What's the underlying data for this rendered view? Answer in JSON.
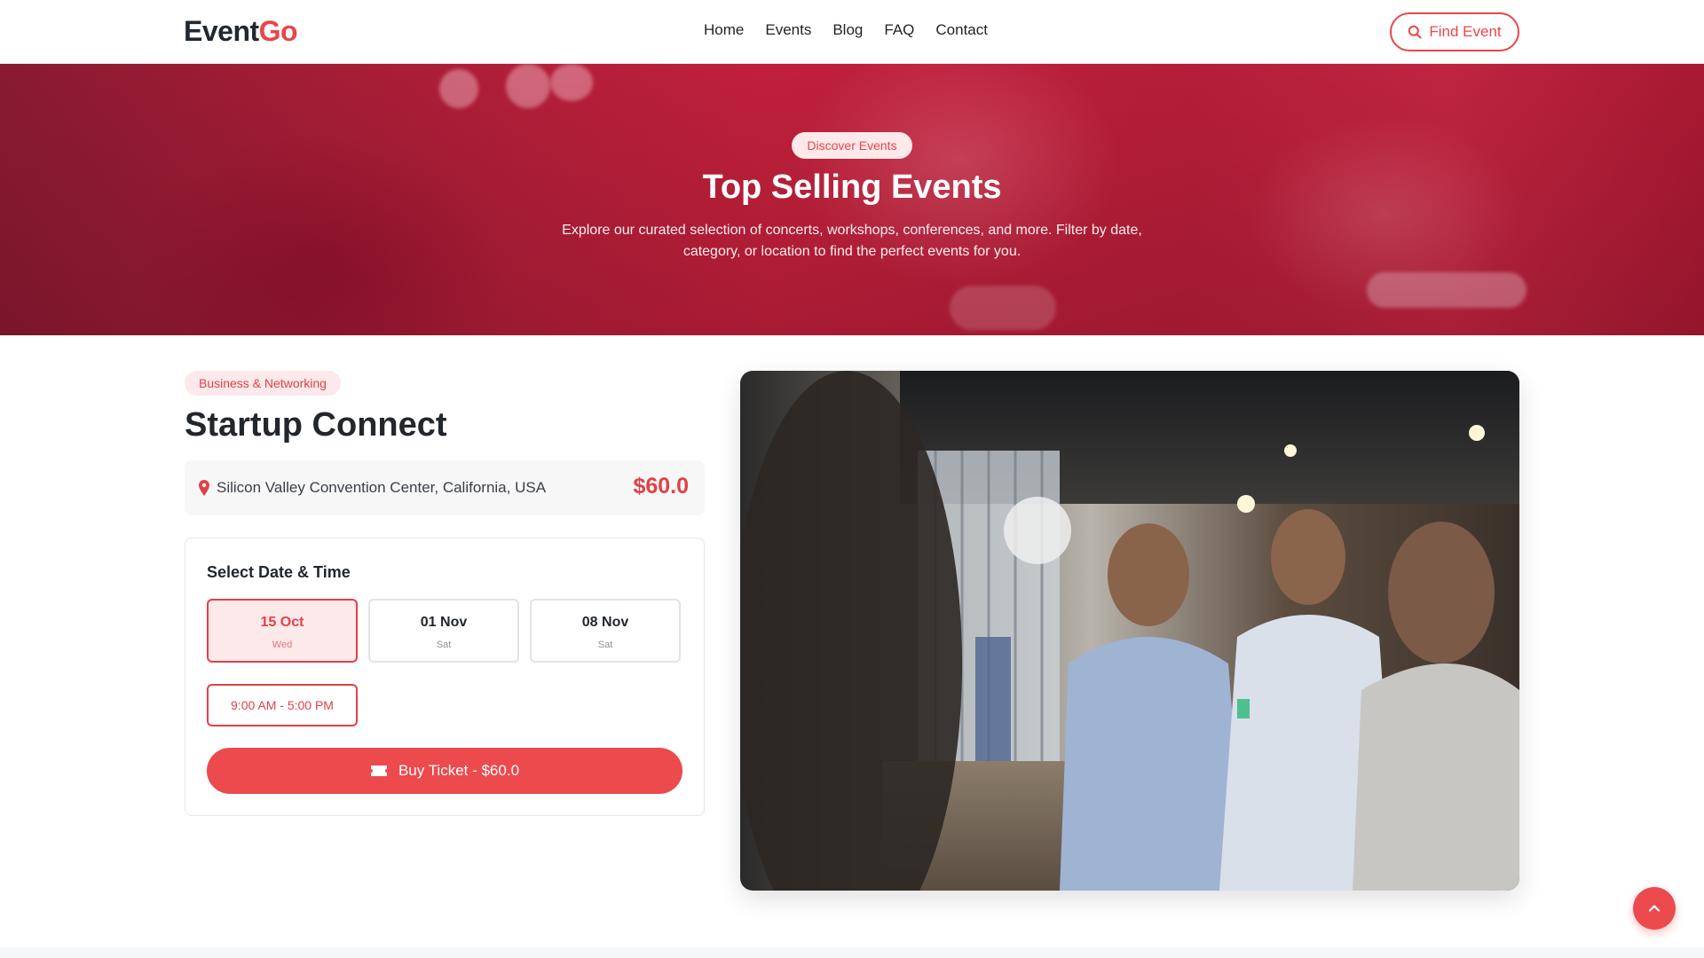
{
  "brand": {
    "name_part1": "Event",
    "name_part2": "Go",
    "accent_color": "#e9464a"
  },
  "nav": {
    "links": [
      {
        "label": "Home"
      },
      {
        "label": "Events"
      },
      {
        "label": "Blog"
      },
      {
        "label": "FAQ"
      },
      {
        "label": "Contact"
      }
    ],
    "find_button": {
      "label": "Find Event",
      "icon": "search-icon"
    }
  },
  "hero": {
    "pill": "Discover Events",
    "title": "Top Selling Events",
    "description": "Explore our curated selection of concerts, workshops, conferences, and more. Filter by date, category, or location to find the perfect events for you."
  },
  "event": {
    "category": "Business & Networking",
    "title": "Startup Connect",
    "location": "Silicon Valley Convention Center, California, USA",
    "location_icon": "map-pin-icon",
    "price": "$60.0"
  },
  "booking": {
    "title": "Select Date & Time",
    "dates": [
      {
        "date": "15 Oct",
        "day": "Wed",
        "selected": true
      },
      {
        "date": "01 Nov",
        "day": "Sat",
        "selected": false
      },
      {
        "date": "08 Nov",
        "day": "Sat",
        "selected": false
      }
    ],
    "time_slot": "9:00 AM - 5:00 PM",
    "buy_button": {
      "label": "Buy Ticket - $60.0",
      "icon": "ticket-icon"
    }
  },
  "scroll_top": {
    "icon": "chevron-up-icon"
  }
}
